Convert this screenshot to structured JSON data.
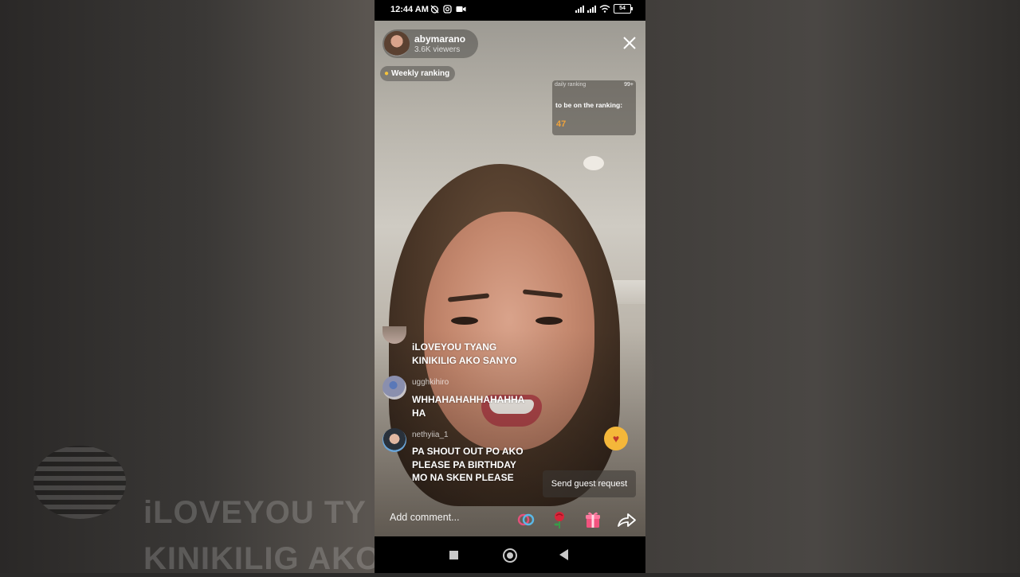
{
  "status_bar": {
    "time": "12:44 AM",
    "battery": "54"
  },
  "live": {
    "host_name": "abymarano",
    "viewers": "3.6K viewers",
    "weekly_ranking_label": "Weekly ranking",
    "daily_ranking": {
      "label": "daily ranking",
      "count": "99+",
      "message": "to be on the ranking:",
      "value": "47"
    }
  },
  "comments": [
    {
      "user": "",
      "text_line1": "iLOVEYOU TYANG",
      "text_line2": "KINIKILIG AKO SANYO",
      "text_line3": ""
    },
    {
      "user": "ugghkihiro",
      "text_line1": "WHHAHAHAHHAHAHHA",
      "text_line2": "HA",
      "text_line3": ""
    },
    {
      "user": "nethyiia_1",
      "text_line1": "PA SHOUT OUT PO AKO",
      "text_line2": "PLEASE PA BIRTHDAY",
      "text_line3": "MO NA SKEN PLEASE"
    }
  ],
  "guest_request_label": "Send guest request",
  "comment_placeholder": "Add comment...",
  "icons": {
    "close": "close-icon",
    "multi_guest": "link-rings-icon",
    "rose": "rose-icon",
    "gift": "gift-icon",
    "share": "share-icon"
  },
  "background_overlay": {
    "line1": "iLOVEYOU TY",
    "line2": "KINIKILIG AKO"
  }
}
